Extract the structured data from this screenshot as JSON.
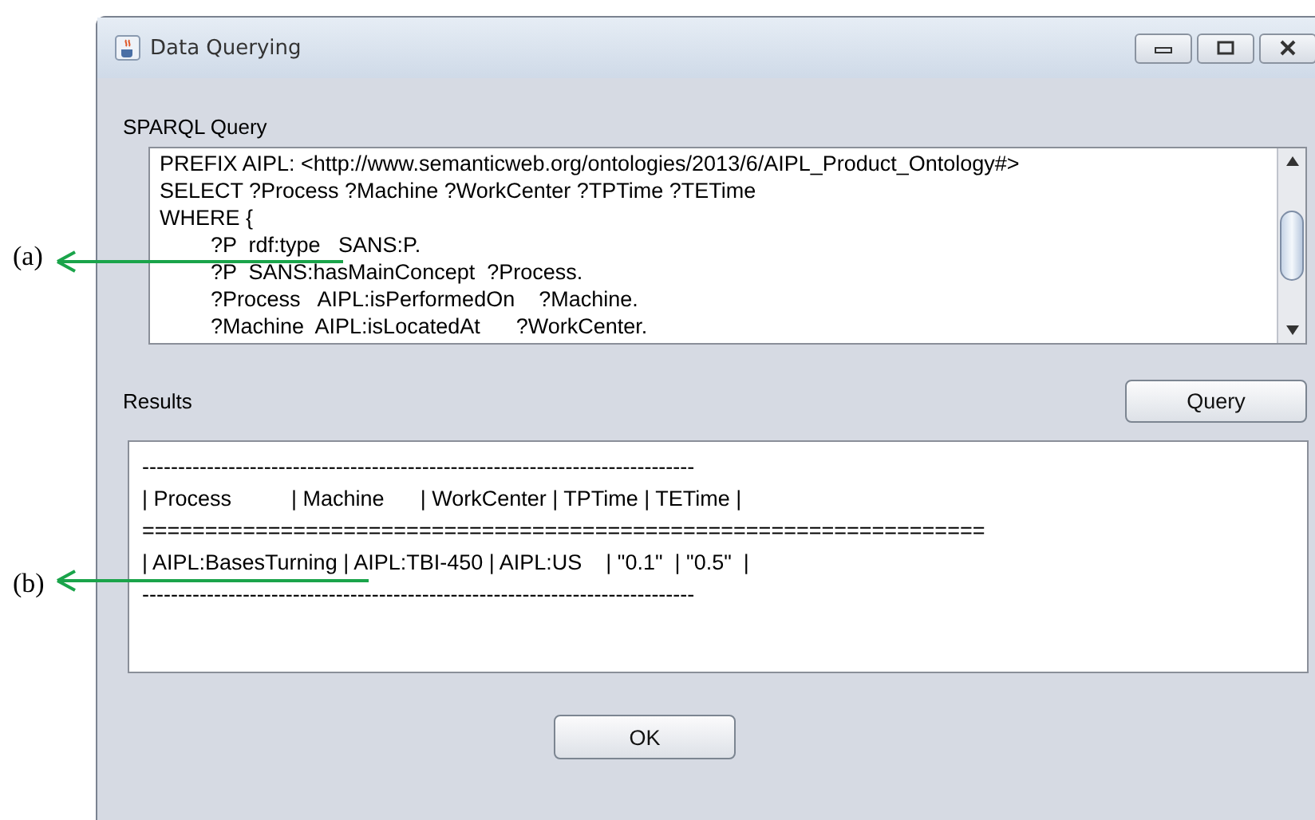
{
  "window": {
    "title": "Data Querying"
  },
  "query": {
    "label": "SPARQL Query",
    "lines": [
      {
        "text": "PREFIX AIPL: <http://www.semanticweb.org/ontologies/2013/6/AIPL_Product_Ontology#>"
      },
      {
        "text": "SELECT ?Process ?Machine ?WorkCenter ?TPTime ?TETime"
      },
      {
        "text": "WHERE {",
        "children": [
          {
            "text": "?P  rdf:type   SANS:P."
          },
          {
            "text": "?P  SANS:hasMainConcept  ?Process."
          },
          {
            "text": "?Process   AIPL:isPerformedOn    ?Machine."
          },
          {
            "text": "?Machine  AIPL:isLocatedAt      ?WorkCenter."
          }
        ]
      }
    ]
  },
  "results": {
    "label": "Results",
    "button": "Query",
    "lines": [
      "-----------------------------------------------------------------------------",
      "| Process          | Machine      | WorkCenter | TPTime | TETime |",
      "===================================================================",
      "| AIPL:BasesTurning | AIPL:TBI-450 | AIPL:US    | \"0.1\"  | \"0.5\"  |",
      "-----------------------------------------------------------------------------"
    ]
  },
  "ok_button": "OK",
  "annotations": [
    "(a)",
    "(b)"
  ]
}
